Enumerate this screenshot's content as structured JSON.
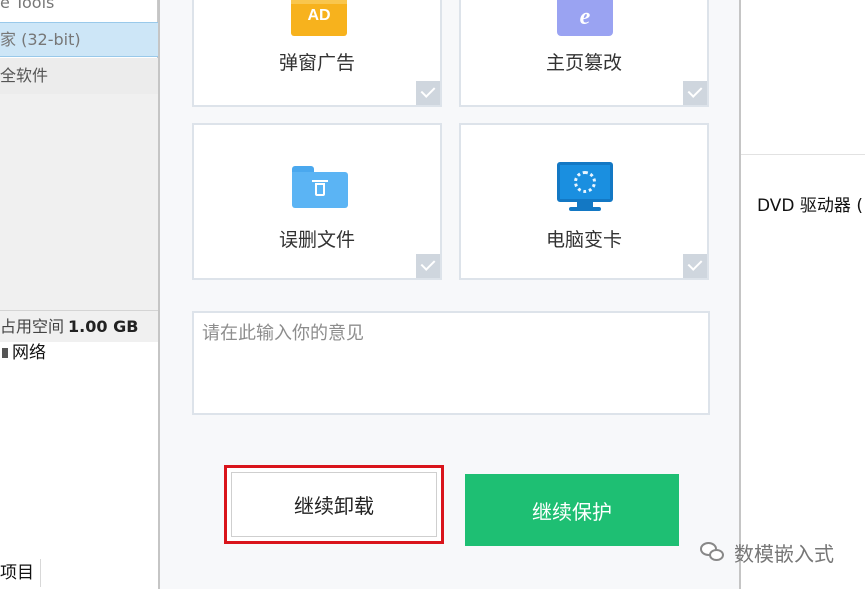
{
  "background_left": {
    "rows": [
      "e Tools",
      "家 (32-bit)",
      "全软件"
    ],
    "footer_label": "占用空间",
    "footer_value": "1.00 GB",
    "network": "网络",
    "items_count": "项目"
  },
  "background_right": {
    "dvd_label": "DVD 驱动器 ("
  },
  "dialog": {
    "cards": [
      {
        "label": "弹窗广告",
        "icon": "ad-icon",
        "icon_text": "AD",
        "checked": true
      },
      {
        "label": "主页篡改",
        "icon": "ie-icon",
        "icon_text": "e",
        "checked": true
      },
      {
        "label": "误删文件",
        "icon": "folder-trash-icon",
        "checked": true
      },
      {
        "label": "电脑变卡",
        "icon": "monitor-loading-icon",
        "checked": true
      }
    ],
    "feedback_placeholder": "请在此输入你的意见",
    "uninstall_label": "继续卸载",
    "protect_label": "继续保护"
  },
  "watermark": {
    "text": "数模嵌入式"
  },
  "colors": {
    "protect_green": "#1ebf73",
    "highlight_red": "#d9141b",
    "ad_orange": "#f7b21d",
    "ie_purple": "#9aa3f2",
    "folder_blue": "#5bb4f4",
    "monitor_blue": "#1a8fe0"
  }
}
